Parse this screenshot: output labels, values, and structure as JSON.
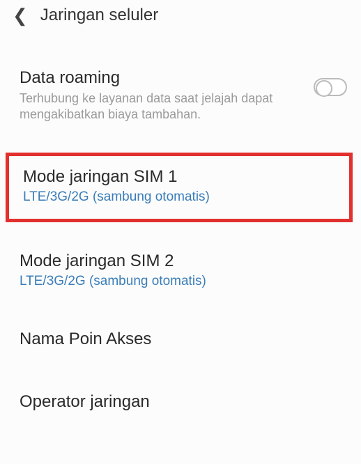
{
  "header": {
    "title": "Jaringan seluler"
  },
  "items": {
    "roaming": {
      "title": "Data roaming",
      "subtitle": "Terhubung ke layanan data saat jelajah dapat mengakibatkan biaya tambahan."
    },
    "sim1": {
      "title": "Mode jaringan SIM 1",
      "subtitle": "LTE/3G/2G (sambung otomatis)"
    },
    "sim2": {
      "title": "Mode jaringan SIM 2",
      "subtitle": "LTE/3G/2G (sambung otomatis)"
    },
    "apn": {
      "title": "Nama Poin Akses"
    },
    "operator": {
      "title": "Operator jaringan"
    }
  }
}
